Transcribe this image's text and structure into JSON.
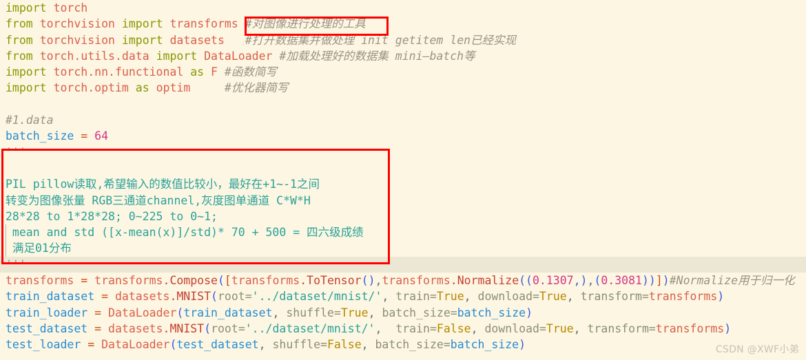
{
  "editor": {
    "background": "#fdf6e3",
    "highlight_background": "#ece6d4",
    "annotation_color": "#ff0000",
    "language": "python"
  },
  "lines": [
    {
      "id": "line-1",
      "text": "import torch",
      "tokens": [
        {
          "t": "import",
          "c": "kw"
        },
        {
          "t": " ",
          "c": "punct"
        },
        {
          "t": "torch",
          "c": "mod"
        }
      ]
    },
    {
      "id": "line-2",
      "text": "from torchvision import transforms #对图像进行处理的工具",
      "tokens": [
        {
          "t": "from",
          "c": "kw"
        },
        {
          "t": " ",
          "c": "punct"
        },
        {
          "t": "torchvision",
          "c": "mod"
        },
        {
          "t": " ",
          "c": "punct"
        },
        {
          "t": "import",
          "c": "kw"
        },
        {
          "t": " ",
          "c": "punct"
        },
        {
          "t": "transforms",
          "c": "mod"
        },
        {
          "t": " ",
          "c": "punct"
        },
        {
          "t": "#对图像进行处理的工具",
          "c": "cmt"
        }
      ]
    },
    {
      "id": "line-3",
      "text": "from torchvision import datasets   #打开数据集并做处理 init getitem len已经实现",
      "tokens": [
        {
          "t": "from",
          "c": "kw"
        },
        {
          "t": " ",
          "c": "punct"
        },
        {
          "t": "torchvision",
          "c": "mod"
        },
        {
          "t": " ",
          "c": "punct"
        },
        {
          "t": "import",
          "c": "kw"
        },
        {
          "t": " ",
          "c": "punct"
        },
        {
          "t": "datasets",
          "c": "mod"
        },
        {
          "t": "   ",
          "c": "punct"
        },
        {
          "t": "#打开数据集并做处理 init getitem len已经实现",
          "c": "cmt"
        }
      ]
    },
    {
      "id": "line-4",
      "text": "from torch.utils.data import DataLoader #加载处理好的数据集 mini—batch等",
      "tokens": [
        {
          "t": "from",
          "c": "kw"
        },
        {
          "t": " ",
          "c": "punct"
        },
        {
          "t": "torch.utils.data",
          "c": "mod"
        },
        {
          "t": " ",
          "c": "punct"
        },
        {
          "t": "import",
          "c": "kw"
        },
        {
          "t": " ",
          "c": "punct"
        },
        {
          "t": "DataLoader",
          "c": "mod"
        },
        {
          "t": " ",
          "c": "punct"
        },
        {
          "t": "#加载处理好的数据集 mini—batch等",
          "c": "cmt"
        }
      ]
    },
    {
      "id": "line-5",
      "text": "import torch.nn.functional as F #函数简写",
      "tokens": [
        {
          "t": "import",
          "c": "kw"
        },
        {
          "t": " ",
          "c": "punct"
        },
        {
          "t": "torch.nn.functional",
          "c": "mod"
        },
        {
          "t": " ",
          "c": "punct"
        },
        {
          "t": "as",
          "c": "kw"
        },
        {
          "t": " ",
          "c": "punct"
        },
        {
          "t": "F",
          "c": "mod"
        },
        {
          "t": " ",
          "c": "punct"
        },
        {
          "t": "#函数简写",
          "c": "cmt"
        }
      ]
    },
    {
      "id": "line-6",
      "text": "import torch.optim as optim     #优化器简写",
      "tokens": [
        {
          "t": "import",
          "c": "kw"
        },
        {
          "t": " ",
          "c": "punct"
        },
        {
          "t": "torch.optim",
          "c": "mod"
        },
        {
          "t": " ",
          "c": "punct"
        },
        {
          "t": "as",
          "c": "kw"
        },
        {
          "t": " ",
          "c": "punct"
        },
        {
          "t": "optim",
          "c": "mod"
        },
        {
          "t": "     ",
          "c": "punct"
        },
        {
          "t": "#优化器简写",
          "c": "cmt"
        }
      ]
    },
    {
      "id": "line-7",
      "text": "",
      "tokens": []
    },
    {
      "id": "line-8",
      "text": "#1.data",
      "tokens": [
        {
          "t": "#1.data",
          "c": "cmt"
        }
      ]
    },
    {
      "id": "line-9",
      "text": "batch_size = 64",
      "tokens": [
        {
          "t": "batch_size",
          "c": "var"
        },
        {
          "t": " ",
          "c": "punct"
        },
        {
          "t": "=",
          "c": "opr"
        },
        {
          "t": " ",
          "c": "punct"
        },
        {
          "t": "64",
          "c": "num"
        }
      ]
    },
    {
      "id": "line-10",
      "text": "'''",
      "tokens": [
        {
          "t": "'''",
          "c": "str"
        }
      ]
    },
    {
      "id": "line-11",
      "text": "",
      "tokens": []
    },
    {
      "id": "line-12",
      "text": "PIL pillow读取,希望输入的数值比较小, 最好在+1~-1之间",
      "tokens": [
        {
          "t": "PIL pillow",
          "c": "str"
        },
        {
          "t": "读取",
          "c": "cn"
        },
        {
          "t": ",",
          "c": "str"
        },
        {
          "t": "希望输入的数值比较小，最好在",
          "c": "cn"
        },
        {
          "t": "+1~-1",
          "c": "str"
        },
        {
          "t": "之间",
          "c": "cn"
        }
      ]
    },
    {
      "id": "line-13",
      "text": "转变为图像张量 RGB三通道channel,灰度图单通道 C*W*H",
      "tokens": [
        {
          "t": "转变为图像张量",
          "c": "cn"
        },
        {
          "t": " RGB",
          "c": "str"
        },
        {
          "t": "三通道",
          "c": "cn"
        },
        {
          "t": "channel",
          "c": "str"
        },
        {
          "t": ",",
          "c": "str"
        },
        {
          "t": "灰度图单通道",
          "c": "cn"
        },
        {
          "t": " C*W*H",
          "c": "str"
        }
      ]
    },
    {
      "id": "line-14",
      "text": "28*28 to 1*28*28; 0~225 to 0~1;",
      "tokens": [
        {
          "t": "28*28 to 1*28*28; 0~225 to 0~1;",
          "c": "str"
        }
      ]
    },
    {
      "id": "line-15",
      "text": " mean and std ([x-mean(x)]/std)* 70 + 500 = 四六级成绩",
      "indent_guide": true,
      "tokens": [
        {
          "t": " mean and std ([x-mean(x)]/std)* 70 + 500 = ",
          "c": "str"
        },
        {
          "t": "四六级成绩",
          "c": "cn"
        }
      ]
    },
    {
      "id": "line-16",
      "text": " 满足01分布",
      "indent_guide": true,
      "tokens": [
        {
          "t": " ",
          "c": "str"
        },
        {
          "t": "满足",
          "c": "cn"
        },
        {
          "t": "01",
          "c": "str"
        },
        {
          "t": "分布",
          "c": "cn"
        }
      ]
    },
    {
      "id": "line-17",
      "text": "'''",
      "highlight": true,
      "tokens": [
        {
          "t": "'''",
          "c": "cmt"
        }
      ]
    },
    {
      "id": "line-18",
      "text": "transforms = transforms.Compose([transforms.ToTensor(),transforms.Normalize((0.1307,),(0.3081))])#Normalize用于归一化",
      "tokens": [
        {
          "t": "transforms",
          "c": "mod"
        },
        {
          "t": " ",
          "c": "punct"
        },
        {
          "t": "=",
          "c": "opr"
        },
        {
          "t": " ",
          "c": "punct"
        },
        {
          "t": "transforms",
          "c": "mod"
        },
        {
          "t": ".",
          "c": "attr"
        },
        {
          "t": "Compose",
          "c": "attr"
        },
        {
          "t": "(",
          "c": "paren"
        },
        {
          "t": "[",
          "c": "brkt"
        },
        {
          "t": "transforms",
          "c": "mod"
        },
        {
          "t": ".",
          "c": "attr"
        },
        {
          "t": "ToTensor",
          "c": "attr"
        },
        {
          "t": "(",
          "c": "paren"
        },
        {
          "t": ")",
          "c": "paren"
        },
        {
          "t": ",",
          "c": "punct"
        },
        {
          "t": "transforms",
          "c": "mod"
        },
        {
          "t": ".",
          "c": "attr"
        },
        {
          "t": "Normalize",
          "c": "attr"
        },
        {
          "t": "((",
          "c": "paren"
        },
        {
          "t": "0.1307",
          "c": "num"
        },
        {
          "t": ",)",
          "c": "paren"
        },
        {
          "t": ",",
          "c": "punct"
        },
        {
          "t": "(",
          "c": "paren"
        },
        {
          "t": "0.3081",
          "c": "num"
        },
        {
          "t": "))",
          "c": "paren"
        },
        {
          "t": "]",
          "c": "brkt"
        },
        {
          "t": ")",
          "c": "paren"
        },
        {
          "t": "#Normalize用于归一化",
          "c": "cmt"
        }
      ]
    },
    {
      "id": "line-19",
      "text": "train_dataset = datasets.MNIST(root='../dataset/mnist/', train=True, download=True, transform=transforms)",
      "tokens": [
        {
          "t": "train_dataset",
          "c": "var"
        },
        {
          "t": " ",
          "c": "punct"
        },
        {
          "t": "=",
          "c": "opr"
        },
        {
          "t": " ",
          "c": "punct"
        },
        {
          "t": "datasets",
          "c": "mod"
        },
        {
          "t": ".",
          "c": "attr"
        },
        {
          "t": "MNIST",
          "c": "attr"
        },
        {
          "t": "(",
          "c": "paren"
        },
        {
          "t": "root",
          "c": "kwarg"
        },
        {
          "t": "=",
          "c": "kwarg"
        },
        {
          "t": "'../dataset/mnist/'",
          "c": "str"
        },
        {
          "t": ",",
          "c": "punct"
        },
        {
          "t": " ",
          "c": "punct"
        },
        {
          "t": "train",
          "c": "kwarg"
        },
        {
          "t": "=",
          "c": "kwarg"
        },
        {
          "t": "True",
          "c": "boolv"
        },
        {
          "t": ",",
          "c": "punct"
        },
        {
          "t": " ",
          "c": "punct"
        },
        {
          "t": "download",
          "c": "kwarg"
        },
        {
          "t": "=",
          "c": "kwarg"
        },
        {
          "t": "True",
          "c": "boolv"
        },
        {
          "t": ",",
          "c": "punct"
        },
        {
          "t": " ",
          "c": "punct"
        },
        {
          "t": "transform",
          "c": "kwarg"
        },
        {
          "t": "=",
          "c": "kwarg"
        },
        {
          "t": "transforms",
          "c": "mod"
        },
        {
          "t": ")",
          "c": "paren"
        }
      ]
    },
    {
      "id": "line-20",
      "text": "train_loader = DataLoader(train_dataset, shuffle=True, batch_size=batch_size)",
      "tokens": [
        {
          "t": "train_loader",
          "c": "var"
        },
        {
          "t": " ",
          "c": "punct"
        },
        {
          "t": "=",
          "c": "opr"
        },
        {
          "t": " ",
          "c": "punct"
        },
        {
          "t": "DataLoader",
          "c": "mod"
        },
        {
          "t": "(",
          "c": "paren"
        },
        {
          "t": "train_dataset",
          "c": "var"
        },
        {
          "t": ",",
          "c": "punct"
        },
        {
          "t": " ",
          "c": "punct"
        },
        {
          "t": "shuffle",
          "c": "kwarg"
        },
        {
          "t": "=",
          "c": "kwarg"
        },
        {
          "t": "True",
          "c": "boolv"
        },
        {
          "t": ",",
          "c": "punct"
        },
        {
          "t": " ",
          "c": "punct"
        },
        {
          "t": "batch_size",
          "c": "kwarg"
        },
        {
          "t": "=",
          "c": "kwarg"
        },
        {
          "t": "batch_size",
          "c": "var"
        },
        {
          "t": ")",
          "c": "paren"
        }
      ]
    },
    {
      "id": "line-21",
      "text": "test_dataset = datasets.MNIST(root='../dataset/mnist/', train=False, download=True, transform=transforms)",
      "tokens": [
        {
          "t": "test_dataset",
          "c": "var"
        },
        {
          "t": " ",
          "c": "punct"
        },
        {
          "t": "=",
          "c": "opr"
        },
        {
          "t": " ",
          "c": "punct"
        },
        {
          "t": "datasets",
          "c": "mod"
        },
        {
          "t": ".",
          "c": "attr"
        },
        {
          "t": "MNIST",
          "c": "attr"
        },
        {
          "t": "(",
          "c": "paren"
        },
        {
          "t": "root",
          "c": "kwarg"
        },
        {
          "t": "=",
          "c": "kwarg"
        },
        {
          "t": "'../dataset/mnist/'",
          "c": "str"
        },
        {
          "t": ",",
          "c": "punct"
        },
        {
          "t": "  ",
          "c": "punct"
        },
        {
          "t": "train",
          "c": "kwarg"
        },
        {
          "t": "=",
          "c": "kwarg"
        },
        {
          "t": "False",
          "c": "boolv"
        },
        {
          "t": ",",
          "c": "punct"
        },
        {
          "t": " ",
          "c": "punct"
        },
        {
          "t": "download",
          "c": "kwarg"
        },
        {
          "t": "=",
          "c": "kwarg"
        },
        {
          "t": "True",
          "c": "boolv"
        },
        {
          "t": ",",
          "c": "punct"
        },
        {
          "t": " ",
          "c": "punct"
        },
        {
          "t": "transform",
          "c": "kwarg"
        },
        {
          "t": "=",
          "c": "kwarg"
        },
        {
          "t": "transforms",
          "c": "mod"
        },
        {
          "t": ")",
          "c": "paren"
        }
      ]
    },
    {
      "id": "line-22",
      "text": "test_loader = DataLoader(test_dataset, shuffle=False, batch_size=batch_size)",
      "tokens": [
        {
          "t": "test_loader",
          "c": "var"
        },
        {
          "t": " ",
          "c": "punct"
        },
        {
          "t": "=",
          "c": "opr"
        },
        {
          "t": " ",
          "c": "punct"
        },
        {
          "t": "DataLoader",
          "c": "mod"
        },
        {
          "t": "(",
          "c": "paren"
        },
        {
          "t": "test_dataset",
          "c": "var"
        },
        {
          "t": ",",
          "c": "punct"
        },
        {
          "t": " ",
          "c": "punct"
        },
        {
          "t": "shuffle",
          "c": "kwarg"
        },
        {
          "t": "=",
          "c": "kwarg"
        },
        {
          "t": "False",
          "c": "boolv"
        },
        {
          "t": ",",
          "c": "punct"
        },
        {
          "t": " ",
          "c": "punct"
        },
        {
          "t": "batch_size",
          "c": "kwarg"
        },
        {
          "t": "=",
          "c": "kwarg"
        },
        {
          "t": "batch_size",
          "c": "var"
        },
        {
          "t": ")",
          "c": "paren"
        }
      ]
    }
  ],
  "annotations": [
    {
      "id": "redbox-1",
      "label": "highlight-box-transforms-comment"
    },
    {
      "id": "redbox-2",
      "label": "highlight-box-docstring"
    }
  ],
  "watermark": {
    "text": "CSDN @XWF小弟"
  }
}
